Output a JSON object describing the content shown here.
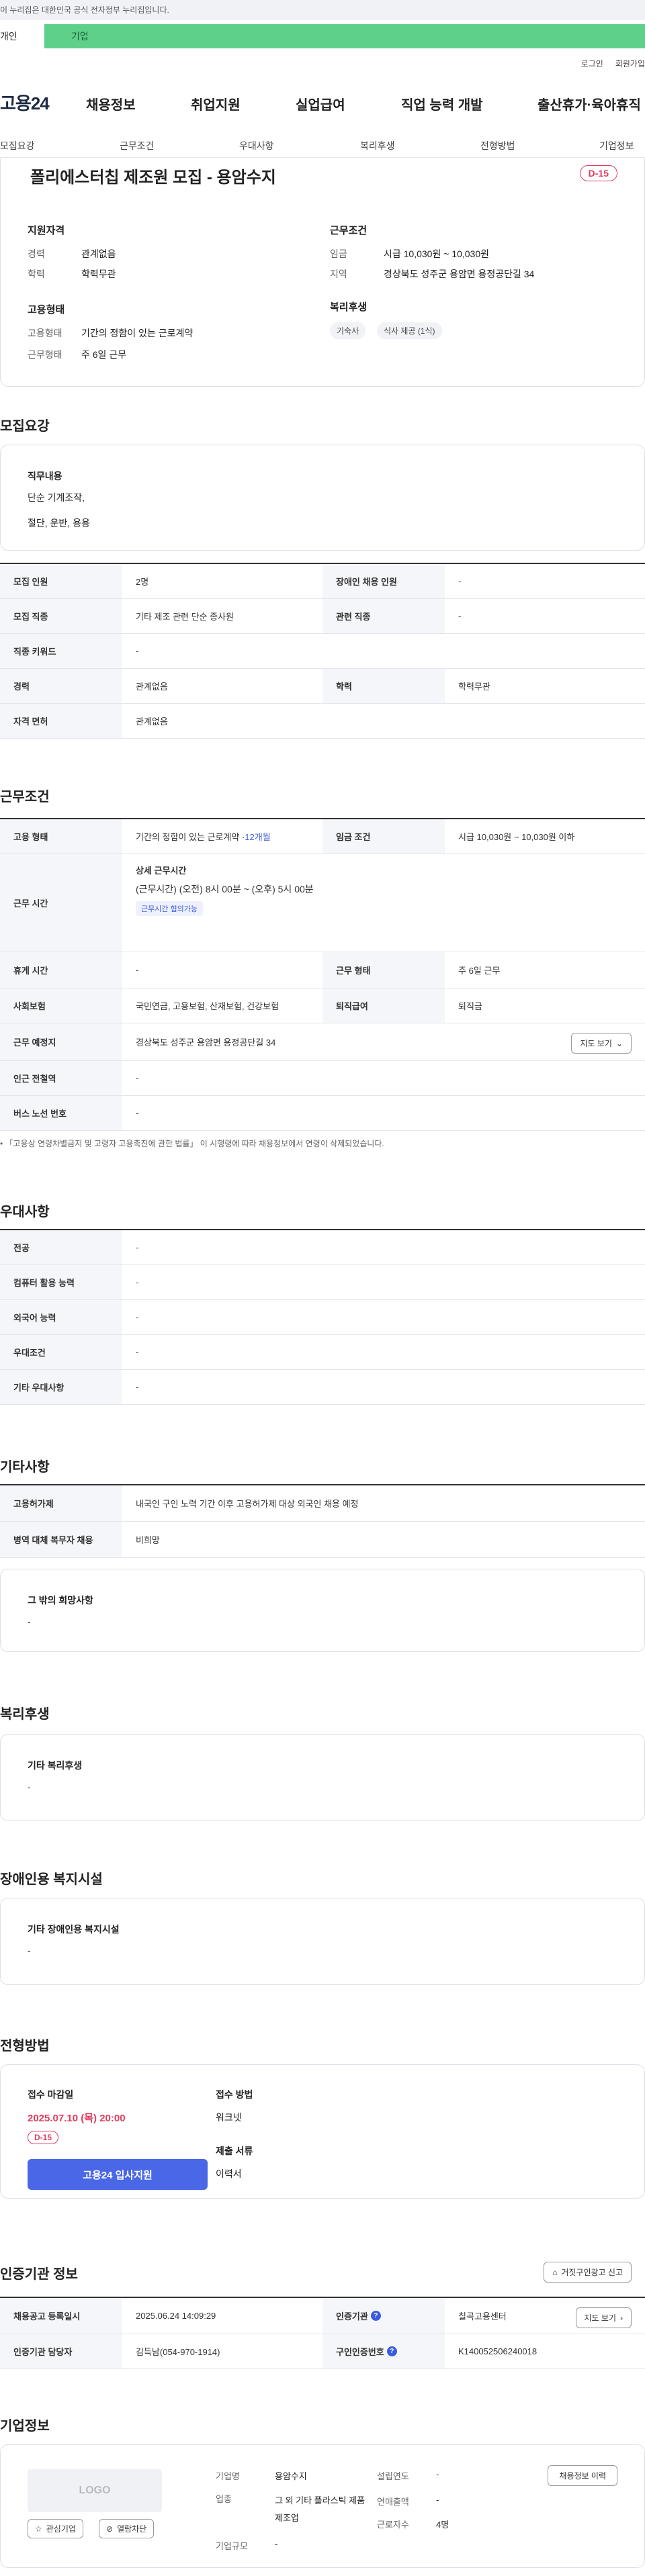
{
  "gov_banner": "이 누리집은 대한민국 공식 전자정부 누리집입니다.",
  "user_tabs": {
    "individual": "개인",
    "business": "기업"
  },
  "util_links": [
    "로그인",
    "회원가입"
  ],
  "gnb": {
    "logo": "고용24",
    "items": [
      "채용정보",
      "취업지원",
      "실업급여",
      "직업 능력 개발",
      "출산휴가·육아휴직"
    ]
  },
  "tabs": [
    "모집요강",
    "근무조건",
    "우대사항",
    "복리후생",
    "전형방법",
    "기업정보"
  ],
  "summary": {
    "title": "폴리에스터칩 제조원 모집 - 용암수지",
    "dday": "D-15",
    "qualification": {
      "heading": "지원자격",
      "career_label": "경력",
      "career_value": "관계없음",
      "edu_label": "학력",
      "edu_value": "학력무관"
    },
    "conditions": {
      "heading": "근무조건",
      "wage_label": "임금",
      "wage_value": "시급 10,030원 ~ 10,030원",
      "region_label": "지역",
      "region_value": "경상북도 성주군 용암면 용정공단길 34"
    },
    "employment": {
      "heading": "고용형태",
      "type_label": "고용형태",
      "type_value": "기간의 정함이 있는 근로계약",
      "days_label": "근무형태",
      "days_value": "주 6일 근무"
    },
    "welfare": {
      "heading": "복리후생",
      "chips": [
        "기숙사",
        "식사 제공 (1식)"
      ]
    }
  },
  "recruit": {
    "section_title": "모집요강",
    "duty_heading": "직무내용",
    "duty_lines": [
      "단순 기계조작,",
      "절단, 운반, 용용"
    ],
    "rows": [
      {
        "h1": "모집 인원",
        "v1": "2명",
        "h2": "장애인 채용 인원",
        "v2": "-"
      },
      {
        "h1": "모집 직종",
        "v1": "기타 제조 관련 단순 종사원",
        "h2": "관련 직종",
        "v2": "-"
      },
      {
        "h1": "직종 키워드",
        "v1": "-"
      },
      {
        "h1": "경력",
        "v1": "관계없음",
        "h2": "학력",
        "v2": "학력무관"
      },
      {
        "h1": "자격 면허",
        "v1": "관계없음"
      }
    ]
  },
  "work": {
    "section_title": "근무조건",
    "employ_h": "고용 형태",
    "employ_v": "기간의 정함이 있는 근로계약 · ",
    "employ_link": "12개월",
    "wage_h": "임금 조건",
    "wage_v": "시급 10,030원 ~ 10,030원 이하",
    "time_h": "근무 시간",
    "time_title": "상세 근무시간",
    "time_detail": "(근무시간) (오전) 8시 00분 ~ (오후) 5시 00분",
    "time_tag": "근무시간 협의가능",
    "rows": [
      {
        "h1": "휴게 시간",
        "v1": "-",
        "h2": "근무 형태",
        "v2": "주 6일 근무"
      },
      {
        "h1": "사회보험",
        "v1": "국민연금, 고용보험, 산재보험, 건강보험",
        "h2": "퇴직급여",
        "v2": "퇴직금"
      }
    ],
    "place_h": "근무 예정지",
    "place_v": "경상북도 성주군 용암면 용정공단길 34",
    "map_btn": "지도 보기",
    "subway_h": "인근 전철역",
    "subway_v": "-",
    "bus_h": "버스 노선 번호",
    "bus_v": "-",
    "note": "「고용상 연령차별금지 및 고령자 고용촉진에 관한 법률」 이 시행령에 따라 채용정보에서 연령이 삭제되었습니다."
  },
  "preference": {
    "section_title": "우대사항",
    "rows": [
      {
        "h": "전공",
        "v": "-"
      },
      {
        "h": "컴퓨터 활용 능력",
        "v": "-"
      },
      {
        "h": "외국어 능력",
        "v": "-"
      },
      {
        "h": "우대조건",
        "v": "-"
      },
      {
        "h": "기타 우대사항",
        "v": "-"
      }
    ]
  },
  "etc": {
    "section_title": "기타사항",
    "rows": [
      {
        "h": "고용허가제",
        "v": "내국인 구인 노력 기간 이후 고용허가제 대상 외국인 채용 예정"
      },
      {
        "h": "병역 대체 복무자 채용",
        "v": "비희망"
      }
    ],
    "box_heading": "그 밖의 희망사항",
    "box_value": "-"
  },
  "benefit": {
    "section_title": "복리후생",
    "box_heading": "기타 복리후생",
    "box_value": "-"
  },
  "disability": {
    "section_title": "장애인용 복지시설",
    "box_heading": "기타 장애인용 복지시설",
    "box_value": "-"
  },
  "selection": {
    "section_title": "전형방법",
    "deadline_label": "접수 마감일",
    "deadline_value": "2025.07.10 (목) 20:00",
    "dday": "D-15",
    "apply_btn": "고용24 입사지원",
    "method_label": "접수 방법",
    "method_value": "워크넷",
    "docs_label": "제출 서류",
    "docs_value": "이력서"
  },
  "cert": {
    "section_title": "인증기관 정보",
    "report_btn": "거짓구인광고 신고",
    "rows": [
      {
        "h1": "채용공고 등록일시",
        "v1": "2025.06.24 14:09:29",
        "h2": "인증기관",
        "v2": "칠곡고용센터"
      },
      {
        "h1": "인증기관 담당자",
        "v1": "김득남(054-970-1914)",
        "h2": "구인인증번호",
        "v2": "K140052506240018"
      }
    ],
    "map_btn": "지도 보기"
  },
  "company": {
    "section_title": "기업정보",
    "logo_text": "LOGO",
    "fav_btn": "관심기업",
    "block_btn": "열람차단",
    "name_label": "기업명",
    "name_value": "용암수지",
    "industry_label": "업종",
    "industry_value": "그 외 기타 플라스틱 제품 제조업",
    "size_label": "기업규모",
    "size_value": "-",
    "founded_label": "설립연도",
    "founded_value": "-",
    "revenue_label": "연매출액",
    "revenue_value": "-",
    "staff_label": "근로자수",
    "staff_value": "4명",
    "jobs_btn": "채용정보 이력"
  }
}
